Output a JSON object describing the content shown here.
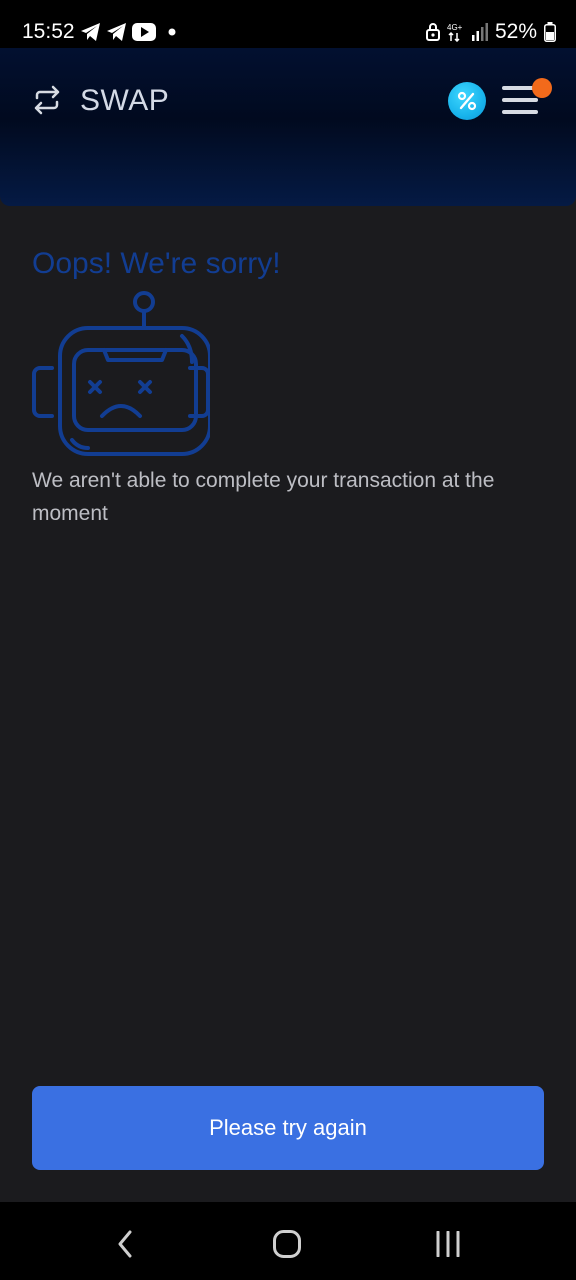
{
  "status_bar": {
    "time": "15:52",
    "notification_icons": [
      "telegram-icon",
      "telegram-icon",
      "youtube-icon",
      "dot-icon"
    ],
    "system_icons": [
      "lock-icon",
      "network-4g-icon",
      "signal-icon",
      "battery-icon"
    ],
    "network_label": "4G+",
    "battery": "52%"
  },
  "header": {
    "title": "SWAP",
    "icons": [
      "swap-icon",
      "percent-icon",
      "menu-icon"
    ],
    "notification_dot_color": "#f26a1b",
    "promo_color": "#18b4ec"
  },
  "error": {
    "title": "Oops! We're sorry!",
    "illustration": "sad-robot-icon",
    "message": "We aren't able to complete your transaction at the moment",
    "accent_color": "#123d92"
  },
  "actions": {
    "retry_label": "Please try again",
    "retry_color": "#3a70e2"
  },
  "nav_bar": {
    "buttons": [
      "back-icon",
      "home-icon",
      "recents-icon"
    ]
  }
}
